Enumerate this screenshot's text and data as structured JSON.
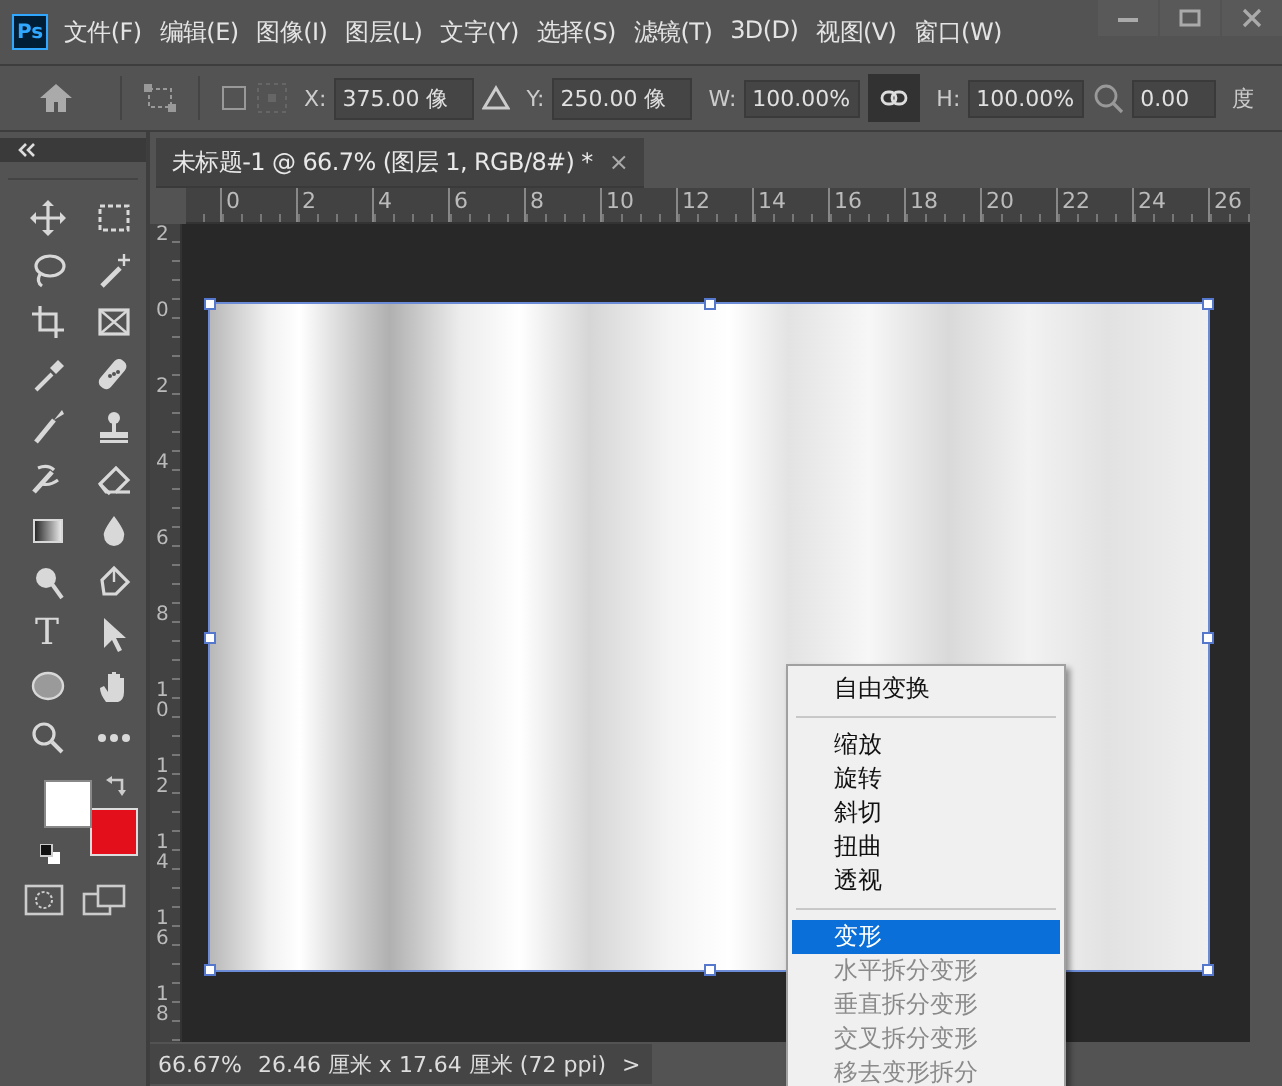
{
  "window": {
    "app_icon": "Ps"
  },
  "menu": [
    "文件(F)",
    "编辑(E)",
    "图像(I)",
    "图层(L)",
    "文字(Y)",
    "选择(S)",
    "滤镜(T)",
    "3D(D)",
    "视图(V)",
    "窗口(W)"
  ],
  "options_bar": {
    "x_label": "X:",
    "x_value": "375.00 像",
    "y_label": "Y:",
    "y_value": "250.00 像",
    "w_label": "W:",
    "w_value": "100.00%",
    "link_on": true,
    "h_label": "H:",
    "h_value": "100.00%",
    "angle_value": "0.00",
    "angle_unit": "度"
  },
  "tools": {
    "type_glyph": "T"
  },
  "swatches": [
    {
      "kind": "foreground",
      "color": "#ffffff"
    },
    {
      "kind": "background",
      "color": "#e3101b"
    }
  ],
  "document_tab": {
    "title": "未标题-1 @ 66.7% (图层 1, RGB/8#) *",
    "close": "×"
  },
  "ruler_h": [
    "0",
    "2",
    "4",
    "6",
    "8",
    "10",
    "12",
    "14",
    "16",
    "18",
    "20",
    "22",
    "24",
    "26"
  ],
  "ruler_v": [
    "2",
    "0",
    "2",
    "4",
    "6",
    "8",
    "10",
    "12",
    "14",
    "16",
    "18"
  ],
  "context_menu": {
    "items": [
      {
        "kind": "item",
        "label": "自由变换",
        "selected": false,
        "disabled": false
      },
      {
        "kind": "separator"
      },
      {
        "kind": "item",
        "label": "缩放",
        "selected": false,
        "disabled": false
      },
      {
        "kind": "item",
        "label": "旋转",
        "selected": false,
        "disabled": false
      },
      {
        "kind": "item",
        "label": "斜切",
        "selected": false,
        "disabled": false
      },
      {
        "kind": "item",
        "label": "扭曲",
        "selected": false,
        "disabled": false
      },
      {
        "kind": "item",
        "label": "透视",
        "selected": false,
        "disabled": false
      },
      {
        "kind": "separator"
      },
      {
        "kind": "item",
        "label": "变形",
        "selected": true,
        "disabled": false
      },
      {
        "kind": "item",
        "label": "水平拆分变形",
        "selected": false,
        "disabled": true
      },
      {
        "kind": "item",
        "label": "垂直拆分变形",
        "selected": false,
        "disabled": true
      },
      {
        "kind": "item",
        "label": "交叉拆分变形",
        "selected": false,
        "disabled": true
      },
      {
        "kind": "item",
        "label": "移去变形拆分",
        "selected": false,
        "disabled": true
      }
    ]
  },
  "status_bar": {
    "zoom": "66.67%",
    "doc_info": "26.46 厘米 x 17.64 厘米 (72 ppi)",
    "arrow": ">"
  }
}
